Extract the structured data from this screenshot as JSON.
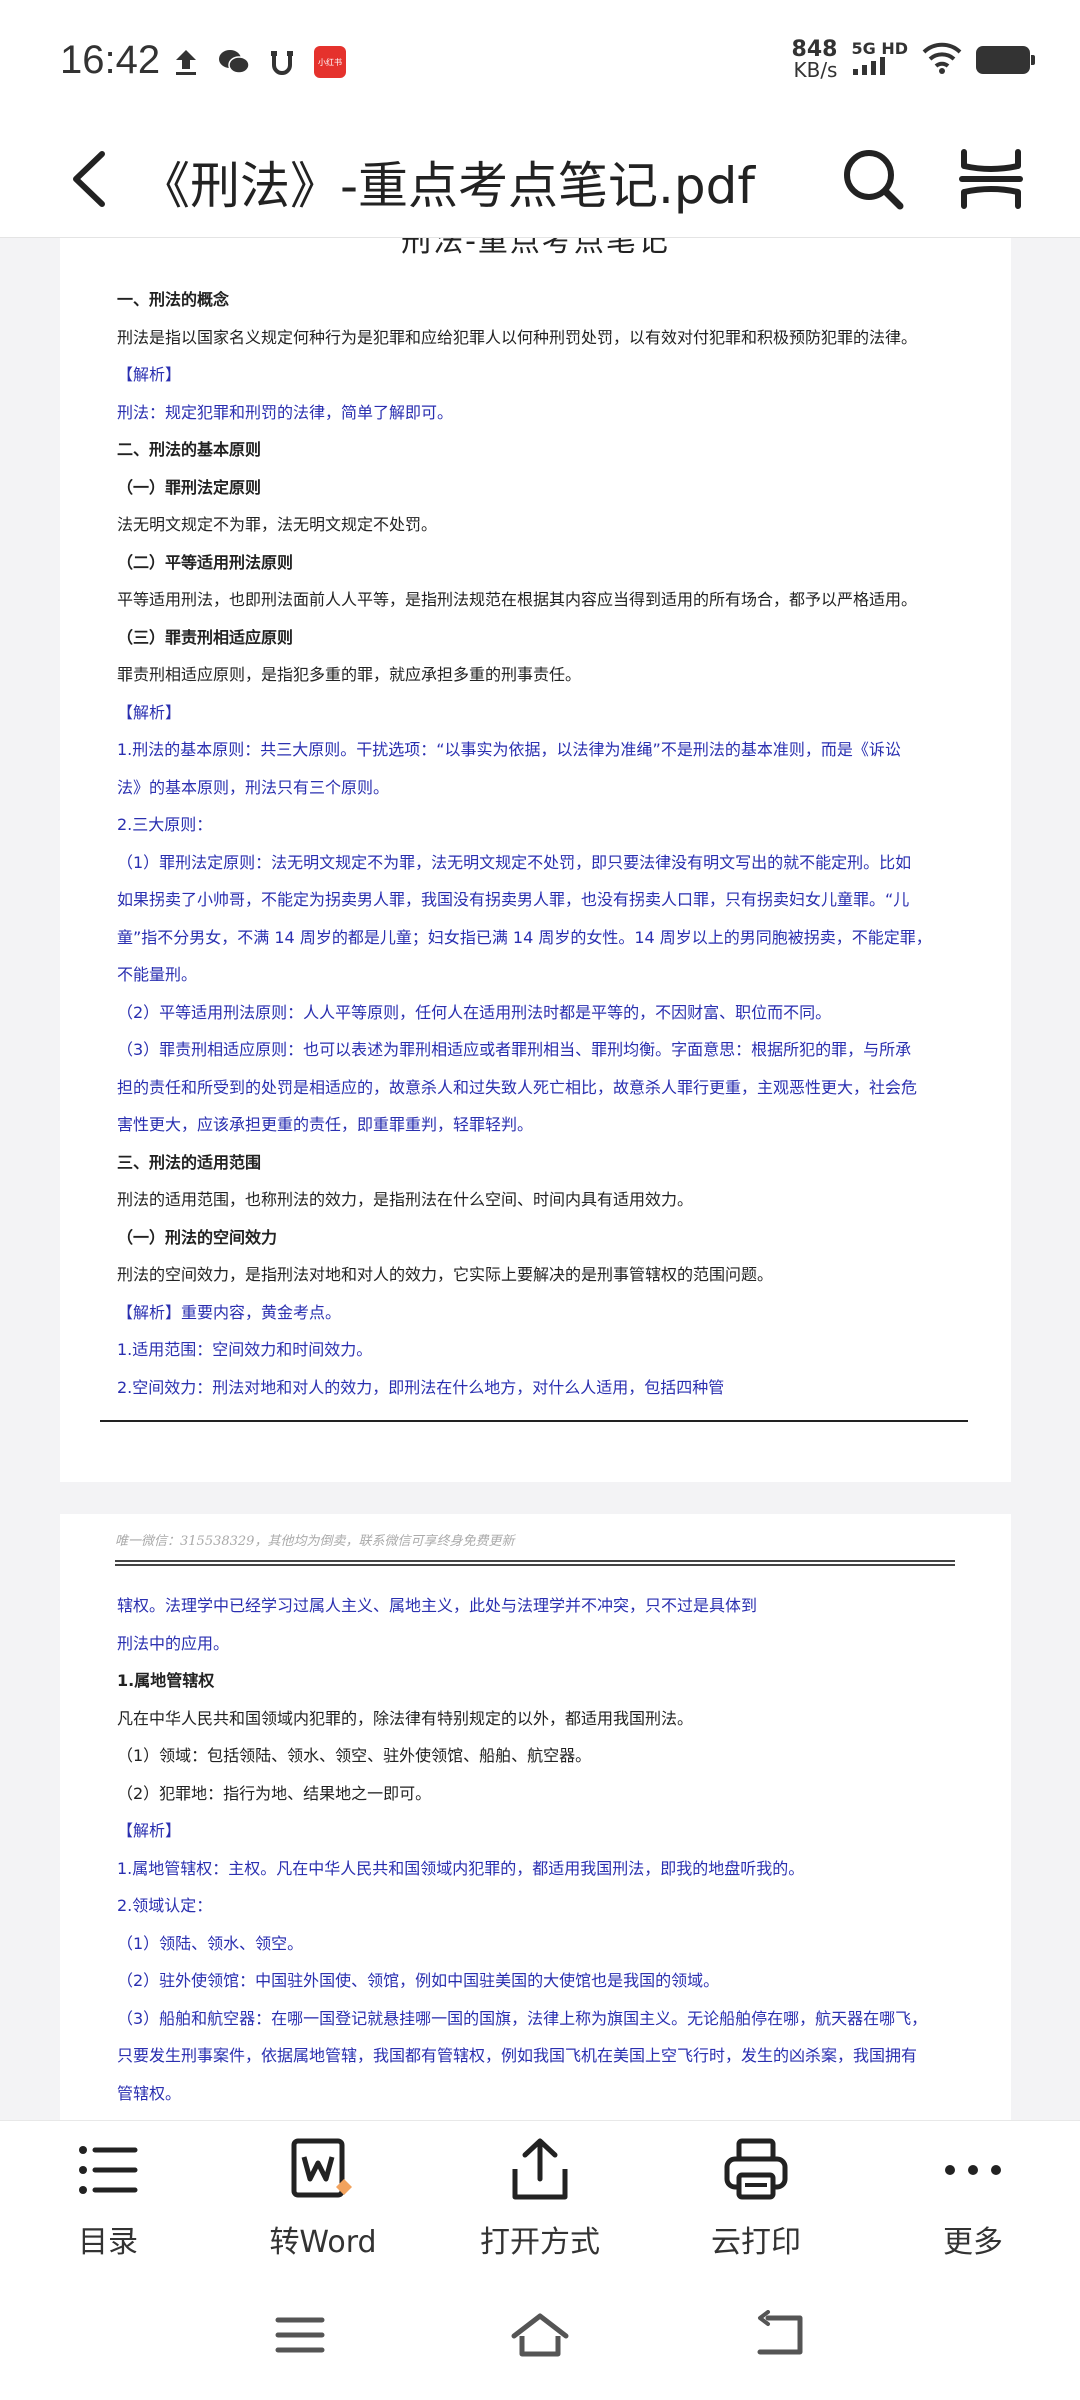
{
  "status_bar": {
    "time": "16:42",
    "net_speed_value": "848",
    "net_speed_unit": "KB/s",
    "net_type": "5G HD",
    "app_badge": "小红书"
  },
  "header": {
    "title": "《刑法》-重点考点笔记.pdf"
  },
  "document": {
    "page1": {
      "title": "刑法-重点考点笔记",
      "lines": [
        {
          "text": "一、刑法的概念",
          "style": "bold"
        },
        {
          "text": "刑法是指以国家名义规定何种行为是犯罪和应给犯罪人以何种刑罚处罚，以有效对付犯罪和积极预防犯罪的法律。",
          "style": "normal"
        },
        {
          "text": "【解析】",
          "style": "blue"
        },
        {
          "text": "刑法：规定犯罪和刑罚的法律，简单了解即可。",
          "style": "blue"
        },
        {
          "text": "二、刑法的基本原则",
          "style": "bold"
        },
        {
          "text": "（一）罪刑法定原则",
          "style": "bold"
        },
        {
          "text": "法无明文规定不为罪，法无明文规定不处罚。",
          "style": "normal"
        },
        {
          "text": "（二）平等适用刑法原则",
          "style": "bold"
        },
        {
          "text": "平等适用刑法，也即刑法面前人人平等，是指刑法规范在根据其内容应当得到适用的所有场合，都予以严格适用。",
          "style": "normal"
        },
        {
          "text": "（三）罪责刑相适应原则",
          "style": "bold"
        },
        {
          "text": "罪责刑相适应原则，是指犯多重的罪，就应承担多重的刑事责任。",
          "style": "normal"
        },
        {
          "text": "【解析】",
          "style": "blue"
        },
        {
          "text": "1.刑法的基本原则：共三大原则。干扰选项：“以事实为依据，以法律为准绳”不是刑法的基本准则，而是《诉讼",
          "style": "blue"
        },
        {
          "text": "法》的基本原则，刑法只有三个原则。",
          "style": "blue"
        },
        {
          "text": "2.三大原则：",
          "style": "blue"
        },
        {
          "text": "（1）罪刑法定原则：法无明文规定不为罪，法无明文规定不处罚，即只要法律没有明文写出的就不能定刑。比如",
          "style": "blue"
        },
        {
          "text": "如果拐卖了小帅哥，不能定为拐卖男人罪，我国没有拐卖男人罪，也没有拐卖人口罪，只有拐卖妇女儿童罪。“儿",
          "style": "blue"
        },
        {
          "text": "童”指不分男女，不满 14 周岁的都是儿童；妇女指已满 14 周岁的女性。14 周岁以上的男同胞被拐卖，不能定罪，",
          "style": "blue"
        },
        {
          "text": "不能量刑。",
          "style": "blue"
        },
        {
          "text": "（2）平等适用刑法原则：人人平等原则，任何人在适用刑法时都是平等的，不因财富、职位而不同。",
          "style": "blue"
        },
        {
          "text": "（3）罪责刑相适应原则：也可以表述为罪刑相适应或者罪刑相当、罪刑均衡。字面意思：根据所犯的罪，与所承",
          "style": "blue"
        },
        {
          "text": "担的责任和所受到的处罚是相适应的，故意杀人和过失致人死亡相比，故意杀人罪行更重，主观恶性更大，社会危",
          "style": "blue"
        },
        {
          "text": "害性更大，应该承担更重的责任，即重罪重判，轻罪轻判。",
          "style": "blue"
        },
        {
          "text": "三、刑法的适用范围",
          "style": "bold"
        },
        {
          "text": "刑法的适用范围，也称刑法的效力，是指刑法在什么空间、时间内具有适用效力。",
          "style": "normal"
        },
        {
          "text": "（一）刑法的空间效力",
          "style": "bold"
        },
        {
          "text": "刑法的空间效力，是指刑法对地和对人的效力，它实际上要解决的是刑事管辖权的范围问题。",
          "style": "normal"
        },
        {
          "text": "【解析】重要内容，黄金考点。",
          "style": "blue"
        },
        {
          "text": "1.适用范围：空间效力和时间效力。",
          "style": "blue"
        },
        {
          "text": "2.空间效力：刑法对地和对人的效力，即刑法在什么地方，对什么人适用，包括四种管",
          "style": "blue"
        }
      ]
    },
    "page2": {
      "watermark": "唯一微信：315538329，其他均为倒卖，联系微信可享终身免费更新",
      "lines": [
        {
          "text": "辖权。法理学中已经学习过属人主义、属地主义，此处与法理学并不冲突，只不过是具体到",
          "style": "blue"
        },
        {
          "text": "刑法中的应用。",
          "style": "blue"
        },
        {
          "text": "1.属地管辖权",
          "style": "bold"
        },
        {
          "text": "凡在中华人民共和国领域内犯罪的，除法律有特别规定的以外，都适用我国刑法。",
          "style": "normal"
        },
        {
          "text": "（1）领域：包括领陆、领水、领空、驻外使领馆、船舶、航空器。",
          "style": "normal"
        },
        {
          "text": "（2）犯罪地：指行为地、结果地之一即可。",
          "style": "normal"
        },
        {
          "text": "【解析】",
          "style": "blue"
        },
        {
          "text": "1.属地管辖权：主权。凡在中华人民共和国领域内犯罪的，都适用我国刑法，即我的地盘听我的。",
          "style": "blue"
        },
        {
          "text": "2.领域认定：",
          "style": "blue"
        },
        {
          "text": "（1）领陆、领水、领空。",
          "style": "blue"
        },
        {
          "text": "（2）驻外使领馆：中国驻外国使、领馆，例如中国驻美国的大使馆也是我国的领域。",
          "style": "blue"
        },
        {
          "text": "（3）船舶和航空器：在哪一国登记就悬挂哪一国的国旗，法律上称为旗国主义。无论船舶停在哪，航天器在哪飞，",
          "style": "blue"
        },
        {
          "text": "只要发生刑事案件，依据属地管辖，我国都有管辖权，例如我国飞机在美国上空飞行时，发生的凶杀案，我国拥有",
          "style": "blue"
        },
        {
          "text": "管辖权。",
          "style": "blue"
        }
      ]
    }
  },
  "toolbar": {
    "items": [
      {
        "label": "目录",
        "icon": "list-icon"
      },
      {
        "label": "转Word",
        "icon": "word-convert-icon"
      },
      {
        "label": "打开方式",
        "icon": "share-icon"
      },
      {
        "label": "云打印",
        "icon": "printer-icon"
      },
      {
        "label": "更多",
        "icon": "more-icon"
      }
    ]
  },
  "colors": {
    "annotation_blue": "#2a2fb0",
    "text": "#222222",
    "background": "#f3f3f5"
  }
}
